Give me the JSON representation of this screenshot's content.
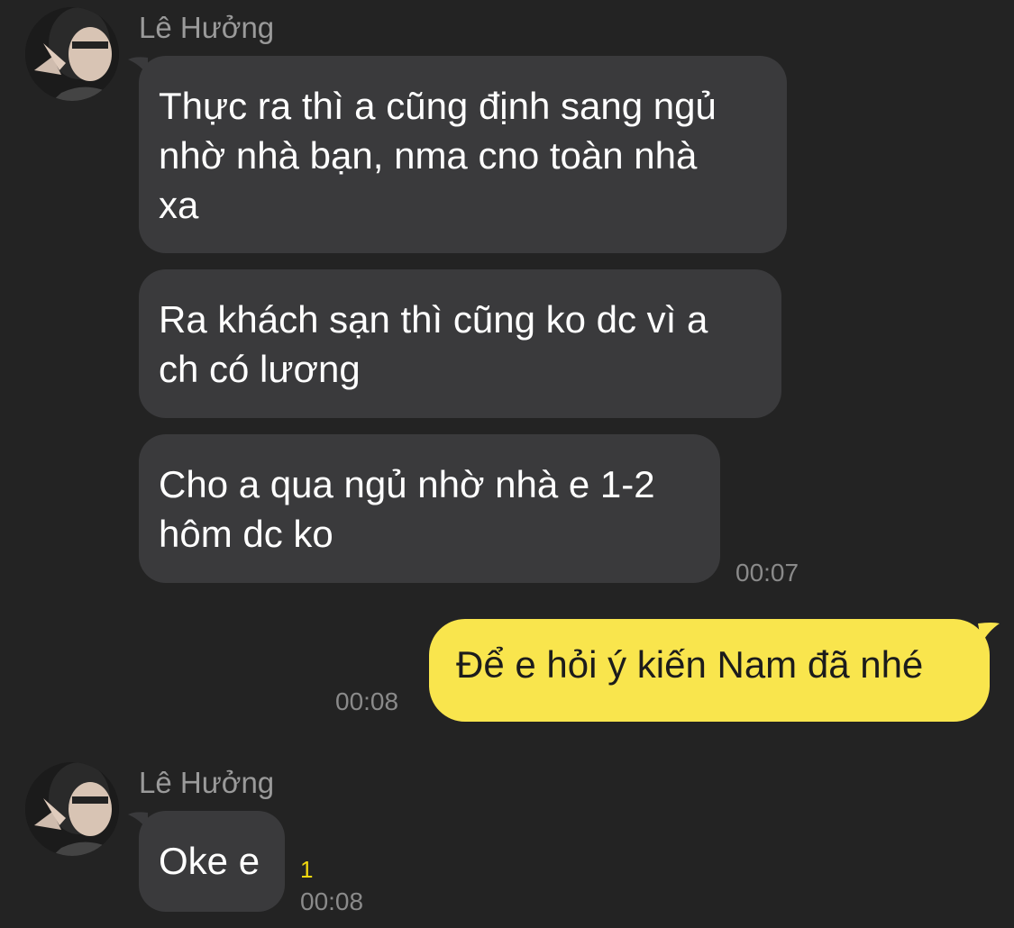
{
  "conversation": {
    "group_1": {
      "sender_name": "Lê Hưởng",
      "messages": [
        {
          "text": "Thực ra thì a cũng định sang ngủ\nnhờ nhà bạn, nma cno toàn nhà\nxa"
        },
        {
          "text": "Ra khách sạn thì cũng ko dc vì a\nch có lương"
        },
        {
          "text": "Cho a qua ngủ nhờ nhà e 1-2\nhôm dc ko"
        }
      ],
      "time": "00:07"
    },
    "outgoing": {
      "text": "Để e hỏi ý kiến Nam đã nhé",
      "time": "00:08"
    },
    "group_2": {
      "sender_name": "Lê Hưởng",
      "messages": [
        {
          "text": "Oke e"
        }
      ],
      "unread_count": "1",
      "time": "00:08"
    }
  },
  "colors": {
    "background": "#232323",
    "incoming_bubble": "#3a3a3c",
    "outgoing_bubble": "#f9e54d",
    "unread_badge_text": "#f2d90f"
  },
  "icons": {
    "avatar": "profile-photo"
  }
}
